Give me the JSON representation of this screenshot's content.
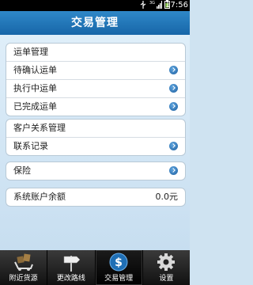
{
  "status_bar": {
    "time": "17:56"
  },
  "title": "交易管理",
  "groups": [
    {
      "items": [
        {
          "label": "运单管理",
          "arrow": false
        },
        {
          "label": "待确认运单",
          "arrow": true
        },
        {
          "label": "执行中运单",
          "arrow": true
        },
        {
          "label": "已完成运单",
          "arrow": true
        }
      ]
    },
    {
      "items": [
        {
          "label": "客户关系管理",
          "arrow": false
        },
        {
          "label": "联系记录",
          "arrow": true
        }
      ]
    },
    {
      "items": [
        {
          "label": "保险",
          "arrow": true
        }
      ]
    },
    {
      "items": [
        {
          "label": "系统账户余额",
          "value": "0.0元"
        }
      ]
    }
  ],
  "tabs": [
    {
      "label": "附近货源",
      "icon": "truck-cargo-icon"
    },
    {
      "label": "更改路线",
      "icon": "signpost-icon"
    },
    {
      "label": "交易管理",
      "icon": "dollar-icon",
      "active": true
    },
    {
      "label": "设置",
      "icon": "gear-icon"
    }
  ],
  "colors": {
    "title_bar": "#1f74b6",
    "arrow": "#2a72b5",
    "tab_bar": "#222222"
  }
}
